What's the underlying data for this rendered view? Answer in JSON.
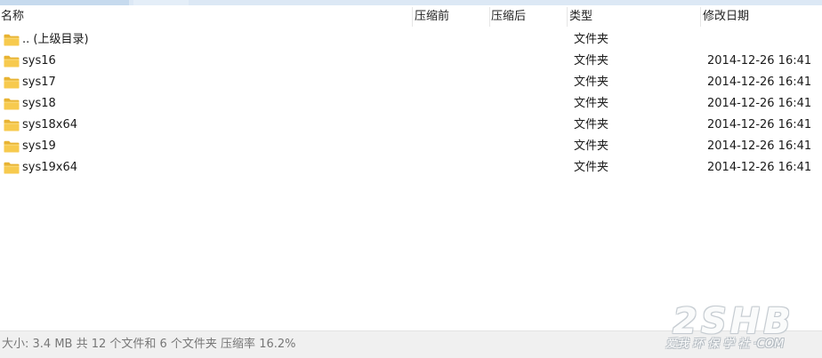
{
  "columns": {
    "name": "名称",
    "packed": "压缩前",
    "unpacked": "压缩后",
    "type": "类型",
    "modified": "修改日期"
  },
  "rows": [
    {
      "name": ".. (上级目录)",
      "type": "文件夹",
      "date": ""
    },
    {
      "name": "sys16",
      "type": "文件夹",
      "date": "2014-12-26 16:41"
    },
    {
      "name": "sys17",
      "type": "文件夹",
      "date": "2014-12-26 16:41"
    },
    {
      "name": "sys18",
      "type": "文件夹",
      "date": "2014-12-26 16:41"
    },
    {
      "name": "sys18x64",
      "type": "文件夹",
      "date": "2014-12-26 16:41"
    },
    {
      "name": "sys19",
      "type": "文件夹",
      "date": "2014-12-26 16:41"
    },
    {
      "name": "sys19x64",
      "type": "文件夹",
      "date": "2014-12-26 16:41"
    }
  ],
  "status": {
    "text": "大小: 3.4 MB 共 12 个文件和 6 个文件夹 压缩率 16.2%"
  },
  "watermark": {
    "logo": "2SHB",
    "tagline": "爱我 环 保 学 社 ·COM"
  },
  "icons": {
    "folder": "folder-icon"
  },
  "colors": {
    "folder_body": "#f5c84a",
    "folder_tab": "#e8b332",
    "statusbar_bg": "#f0f0f0",
    "top_strip": "#dce8f5"
  }
}
